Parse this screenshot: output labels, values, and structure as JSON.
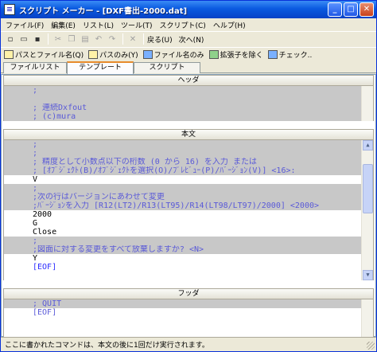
{
  "window": {
    "title": "スクリプト メーカー - [DXF書出-2000.dat]",
    "minimize": "_",
    "maximize": "□",
    "close": "✕"
  },
  "menu": [
    "ファイル(F)",
    "編集(E)",
    "リスト(L)",
    "ツール(T)",
    "スクリプト(C)",
    "ヘルプ(H)"
  ],
  "toolbar": {
    "back_label": "戻る(U)",
    "next_label": "次へ(N)"
  },
  "toolbar2": [
    {
      "label": "パスとファイル名(Q)",
      "icon": "path-file-icon"
    },
    {
      "label": "パスのみ(Y)",
      "icon": "path-icon"
    },
    {
      "label": "ファイル名のみ",
      "icon": "filename-icon"
    },
    {
      "label": "拡張子を除く",
      "icon": "extension-icon"
    },
    {
      "label": "チェック..",
      "icon": "check-icon"
    }
  ],
  "tabs": [
    "ファイルリスト",
    "テンプレート",
    "スクリプト"
  ],
  "sections": {
    "header": {
      "title": "ヘッダ",
      "lines": [
        ";",
        "",
        "; 連続Dxfout",
        "; (c)mura"
      ]
    },
    "body": {
      "title": "本文",
      "lines": [
        ";",
        ";",
        "; 精度として小数点以下の桁数 (0 から 16) を入力 または",
        "; [ｵﾌﾞｼﾞｪｸﾄ(B)/ｵﾌﾞｼﾞｪｸﾄを選択(O)/ﾌﾟﾚﾋﾞｭｰ(P)/ﾊﾞｰｼﾞｮﾝ(V)] <16>:",
        "V",
        ";",
        ";次の行はバージョンにあわせて変更",
        ";ﾊﾞｰｼﾞｮﾝを入力 [R12(LT2)/R13(LT95)/R14(LT98/LT97)/2000] <2000>",
        "2000",
        "G",
        "Close",
        ";",
        ";図面に対する変更をすべて放棄しますか? <N>",
        "Y",
        "[EOF]"
      ]
    },
    "footer": {
      "title": "フッダ",
      "lines": [
        "; QUIT",
        "[EOF]"
      ]
    }
  },
  "status": "ここに書かれたコマンドは、本文の後に1回だけ実行されます。"
}
